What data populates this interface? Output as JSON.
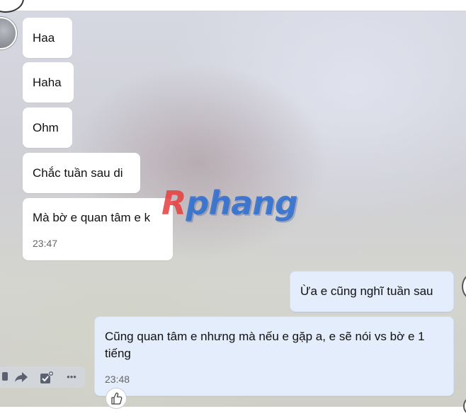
{
  "messages": {
    "recv1": "Haa",
    "recv2": "Haha",
    "recv3": "Ohm",
    "recv4": "Chắc tuần sau di",
    "recv5": "Mà bờ e quan tâm e k",
    "recv5_time": "23:47",
    "sent1": "Ừa e cũng nghĩ tuần sau",
    "sent2": "Cũng quan tâm e nhưng mà nếu e gặp a, e sẽ nói vs bờ e 1 tiếng",
    "sent2_time": "23:48"
  },
  "watermark": {
    "first": "R",
    "rest": "phang"
  },
  "toolbar": {
    "icons": [
      "reply-icon",
      "forward-icon",
      "task-icon",
      "more-icon"
    ],
    "more_glyph": "•••"
  },
  "reaction": {
    "icon": "thumbs-up-icon"
  },
  "colors": {
    "received_bubble": "#ffffff",
    "sent_bubble": "#e4edfb",
    "watermark_red": "#e63c3c",
    "watermark_blue": "#2d6ed2"
  }
}
